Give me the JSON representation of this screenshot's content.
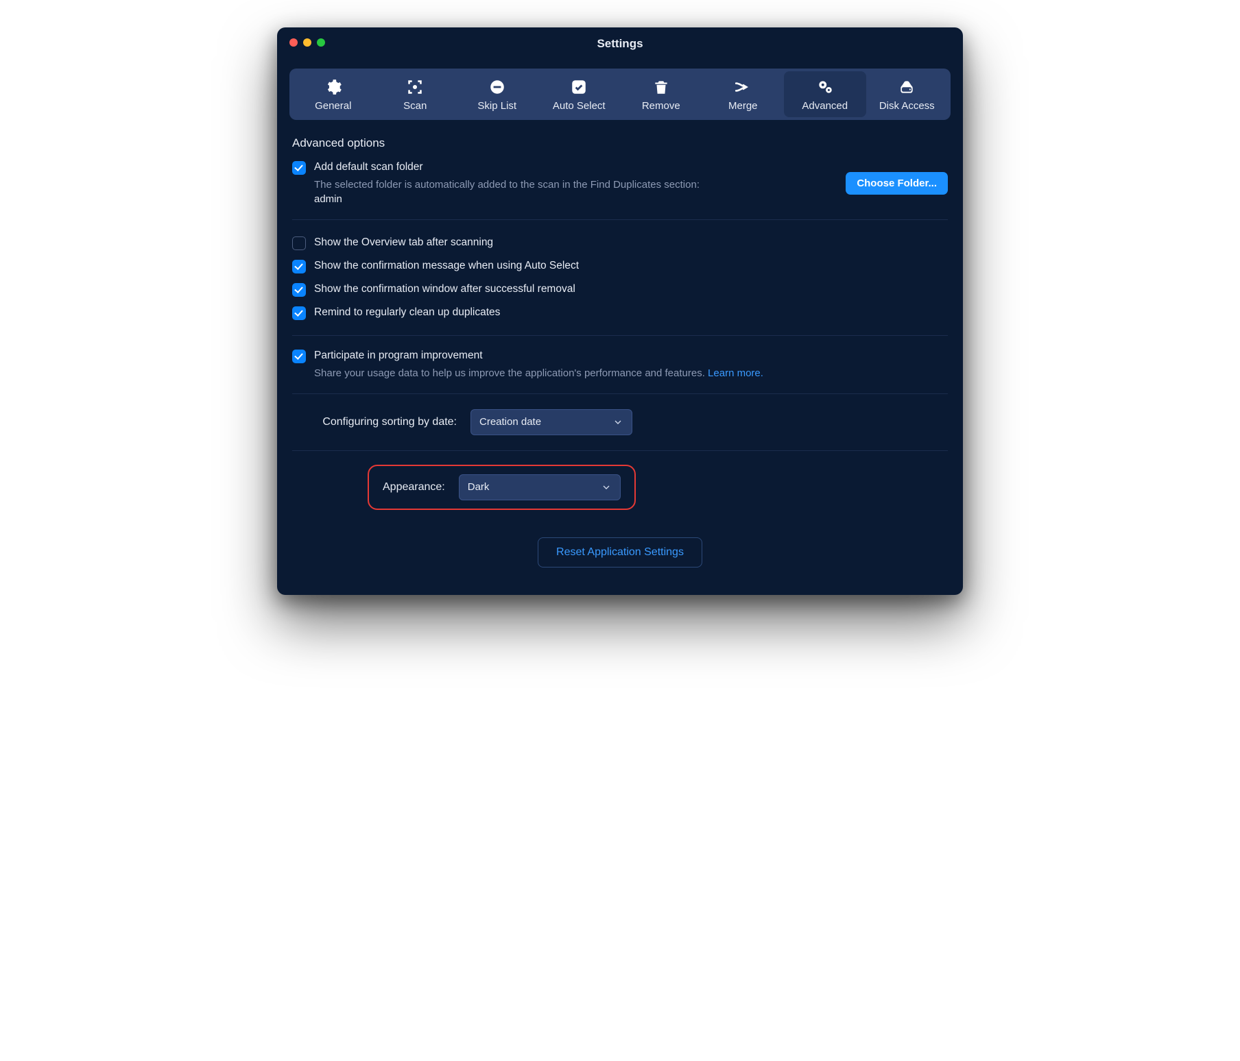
{
  "window": {
    "title": "Settings"
  },
  "tabs": {
    "general": "General",
    "scan": "Scan",
    "skip": "Skip List",
    "auto": "Auto Select",
    "remove": "Remove",
    "merge": "Merge",
    "advanced": "Advanced",
    "disk": "Disk Access"
  },
  "section": {
    "title": "Advanced options"
  },
  "opts": {
    "addFolder": {
      "label": "Add default scan folder",
      "desc": "The selected folder is automatically added to the scan in the Find Duplicates section:",
      "folder": "admin",
      "button": "Choose Folder..."
    },
    "overview": "Show the Overview tab after scanning",
    "confirmAuto": "Show the confirmation message when using Auto Select",
    "confirmRemove": "Show the confirmation window after successful removal",
    "remind": "Remind to regularly clean up duplicates",
    "improve": {
      "label": "Participate in program improvement",
      "desc": "Share your usage data to help us improve the application's performance and features. ",
      "link": "Learn more."
    }
  },
  "sorting": {
    "label": "Configuring sorting by date:",
    "value": "Creation date"
  },
  "appearance": {
    "label": "Appearance:",
    "value": "Dark"
  },
  "reset": "Reset Application Settings"
}
